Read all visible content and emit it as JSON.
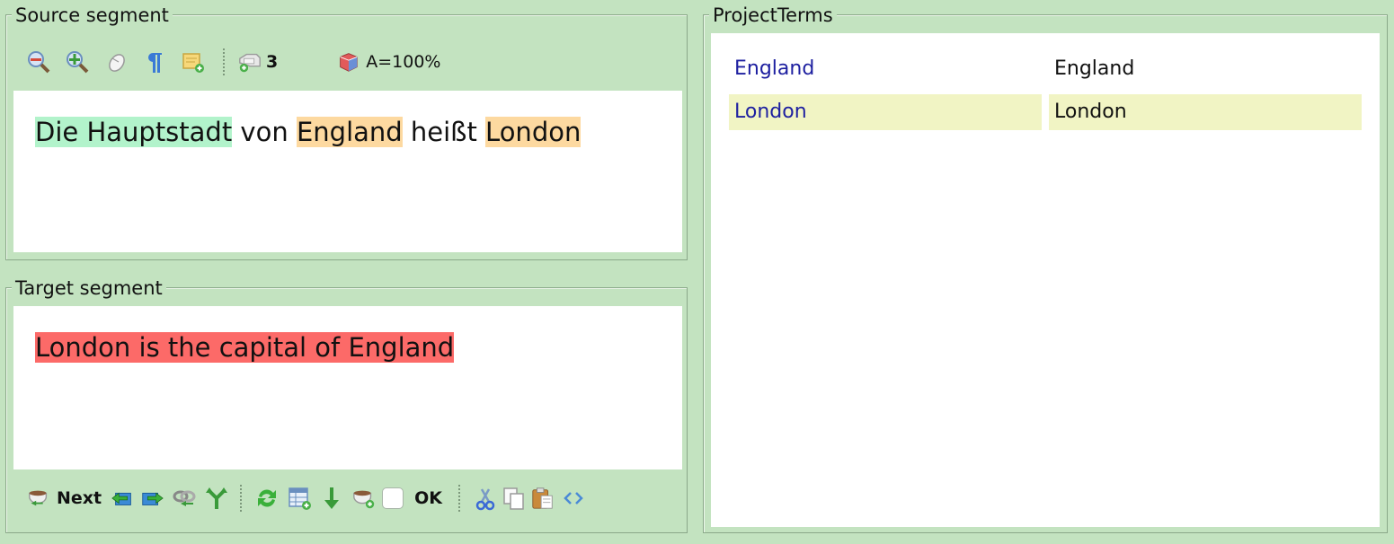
{
  "source_panel": {
    "title": "Source segment",
    "toolbar": {
      "icons": [
        "zoom-out-icon",
        "zoom-in-icon",
        "mouse-icon",
        "pilcrow-icon",
        "add-note-icon",
        "tags-icon",
        "match-icon"
      ],
      "tag_count": "3",
      "match_label": "A=100%"
    },
    "segments": [
      {
        "text": "Die Hauptstadt",
        "highlight": "green"
      },
      {
        "text": " von ",
        "highlight": "none"
      },
      {
        "text": "England",
        "highlight": "orange"
      },
      {
        "text": " heißt ",
        "highlight": "none"
      },
      {
        "text": "London",
        "highlight": "orange"
      }
    ]
  },
  "target_panel": {
    "title": "Target segment",
    "text": "London is the capital of England",
    "highlight_color": "#fc6a68",
    "toolbar": {
      "next_label": "Next",
      "ok_label": "OK",
      "ok_checked": false
    }
  },
  "terms_panel": {
    "title": "ProjectTerms",
    "rows": [
      {
        "source": "England",
        "target": "England",
        "highlighted": false
      },
      {
        "source": "London",
        "target": "London",
        "highlighted": true
      }
    ]
  },
  "colors": {
    "background": "#c3e3c0",
    "source_term_highlight": "#fdd9a0",
    "matched_phrase_highlight": "#b2f3cb",
    "term_row_highlight": "#f1f4c4"
  }
}
